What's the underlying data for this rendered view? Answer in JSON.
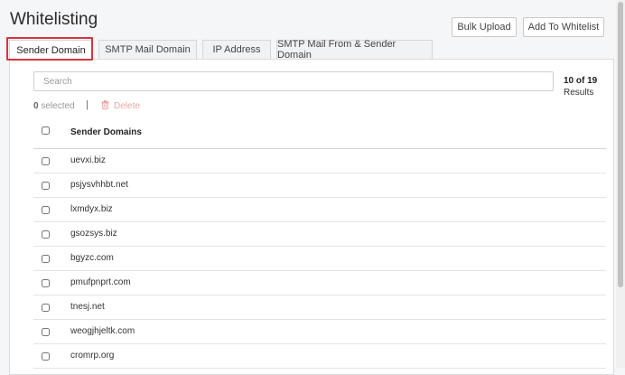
{
  "page": {
    "title": "Whitelisting"
  },
  "header": {
    "bulk_upload_label": "Bulk Upload",
    "add_to_whitelist_label": "Add To Whitelist"
  },
  "tabs": [
    {
      "label": "Sender Domain",
      "active": true
    },
    {
      "label": "SMTP Mail Domain",
      "active": false
    },
    {
      "label": "IP Address",
      "active": false
    },
    {
      "label": "SMTP Mail From & Sender Domain",
      "active": false
    }
  ],
  "search": {
    "placeholder": "Search",
    "value": ""
  },
  "results": {
    "count_text": "10 of 19",
    "label": "Results"
  },
  "selection": {
    "count": "0",
    "label": "selected",
    "separator": "|",
    "delete_label": "Delete"
  },
  "table": {
    "column_header": "Sender Domains",
    "rows": [
      "uevxi.biz",
      "psjysvhhbt.net",
      "lxmdyx.biz",
      "gsozsys.biz",
      "bgyzc.com",
      "pmufpnprt.com",
      "tnesj.net",
      "weogjhjeltk.com",
      "cromrp.org"
    ]
  },
  "colors": {
    "active_tab_outline": "#d9333f",
    "delete_text": "#f1a3a3",
    "page_background": "#f5f6f8"
  }
}
